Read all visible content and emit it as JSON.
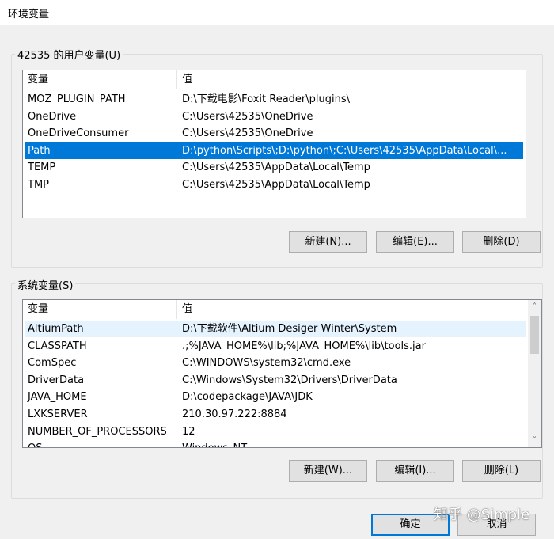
{
  "window": {
    "title": "环境变量"
  },
  "user_vars": {
    "group_label": "42535 的用户变量(U)",
    "col_name": "变量",
    "col_value": "值",
    "rows": [
      {
        "name": "MOZ_PLUGIN_PATH",
        "value": "D:\\下载电影\\Foxit Reader\\plugins\\"
      },
      {
        "name": "OneDrive",
        "value": "C:\\Users\\42535\\OneDrive"
      },
      {
        "name": "OneDriveConsumer",
        "value": "C:\\Users\\42535\\OneDrive"
      },
      {
        "name": "Path",
        "value": "D:\\python\\Scripts\\;D:\\python\\;C:\\Users\\42535\\AppData\\Local\\..."
      },
      {
        "name": "TEMP",
        "value": "C:\\Users\\42535\\AppData\\Local\\Temp"
      },
      {
        "name": "TMP",
        "value": "C:\\Users\\42535\\AppData\\Local\\Temp"
      }
    ],
    "selected_row": 3,
    "buttons": {
      "new": "新建(N)...",
      "edit": "编辑(E)...",
      "delete": "删除(D)"
    }
  },
  "system_vars": {
    "group_label": "系统变量(S)",
    "col_name": "变量",
    "col_value": "值",
    "rows": [
      {
        "name": "AltiumPath",
        "value": "D:\\下载软件\\Altium Desiger Winter\\System"
      },
      {
        "name": "CLASSPATH",
        "value": ".;%JAVA_HOME%\\lib;%JAVA_HOME%\\lib\\tools.jar"
      },
      {
        "name": "ComSpec",
        "value": "C:\\WINDOWS\\system32\\cmd.exe"
      },
      {
        "name": "DriverData",
        "value": "C:\\Windows\\System32\\Drivers\\DriverData"
      },
      {
        "name": "JAVA_HOME",
        "value": "D:\\codepackage\\JAVA\\JDK"
      },
      {
        "name": "LXKSERVER",
        "value": "210.30.97.222:8884"
      },
      {
        "name": "NUMBER_OF_PROCESSORS",
        "value": "12"
      },
      {
        "name": "OS",
        "value": "Windows_NT"
      }
    ],
    "hover_row": 0,
    "buttons": {
      "new": "新建(W)...",
      "edit": "编辑(I)...",
      "delete": "删除(L)"
    }
  },
  "footer": {
    "ok": "确定",
    "cancel": "取消"
  },
  "watermark": "知乎 @Simple",
  "colors": {
    "selection": "#0078d7",
    "hover": "#e5f3ff",
    "focus_border": "#0078d7"
  }
}
